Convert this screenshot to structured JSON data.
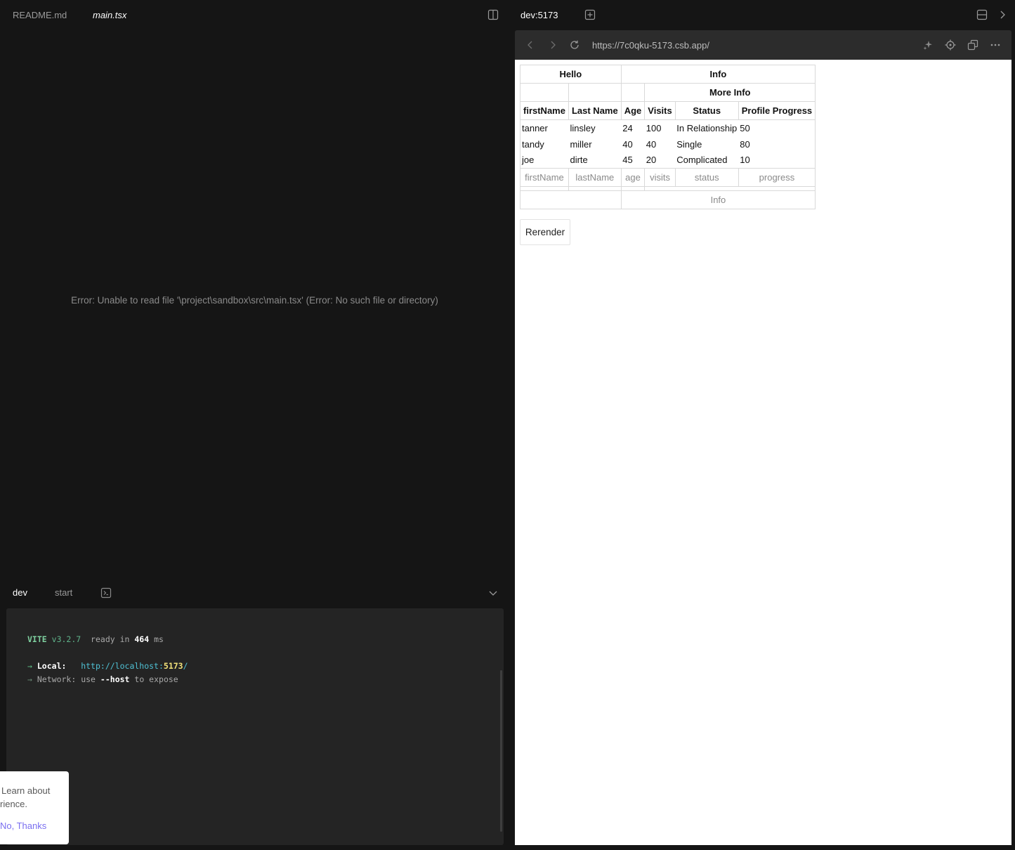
{
  "editor": {
    "tabs": [
      {
        "label": "README.md"
      },
      {
        "label": "main.tsx"
      }
    ],
    "error": "Error: Unable to read file '\\project\\sandbox\\src\\main.tsx' (Error: No such file or directory)"
  },
  "terminal": {
    "tabs": [
      {
        "label": "dev"
      },
      {
        "label": "start"
      }
    ],
    "vite": "VITE",
    "version": "v3.2.7",
    "ready_text": "ready in",
    "ready_ms": "464",
    "ready_unit": "ms",
    "local_label": "Local:",
    "local_url_prefix": "http://localhost:",
    "local_port": "5173",
    "local_url_suffix": "/",
    "network_label": "Network:",
    "network_use": "use",
    "network_flag": "--host",
    "network_rest": "to expose"
  },
  "toast": {
    "line1": "Learn about",
    "line2": "rience.",
    "button": "No, Thanks"
  },
  "preview": {
    "title": "dev:5173",
    "url": "https://7c0qku-5173.csb.app/",
    "table": {
      "group1": {
        "hello": "Hello",
        "info": "Info"
      },
      "group2": {
        "more_info": "More Info"
      },
      "headers": [
        "firstName",
        "Last Name",
        "Age",
        "Visits",
        "Status",
        "Profile Progress"
      ],
      "rows": [
        [
          "tanner",
          "linsley",
          "24",
          "100",
          "In Relationship",
          "50"
        ],
        [
          "tandy",
          "miller",
          "40",
          "40",
          "Single",
          "80"
        ],
        [
          "joe",
          "dirte",
          "45",
          "20",
          "Complicated",
          "10"
        ]
      ],
      "footer": [
        "firstName",
        "lastName",
        "age",
        "visits",
        "status",
        "progress"
      ],
      "footer_group": {
        "info": "Info"
      }
    },
    "rerender": "Rerender"
  }
}
